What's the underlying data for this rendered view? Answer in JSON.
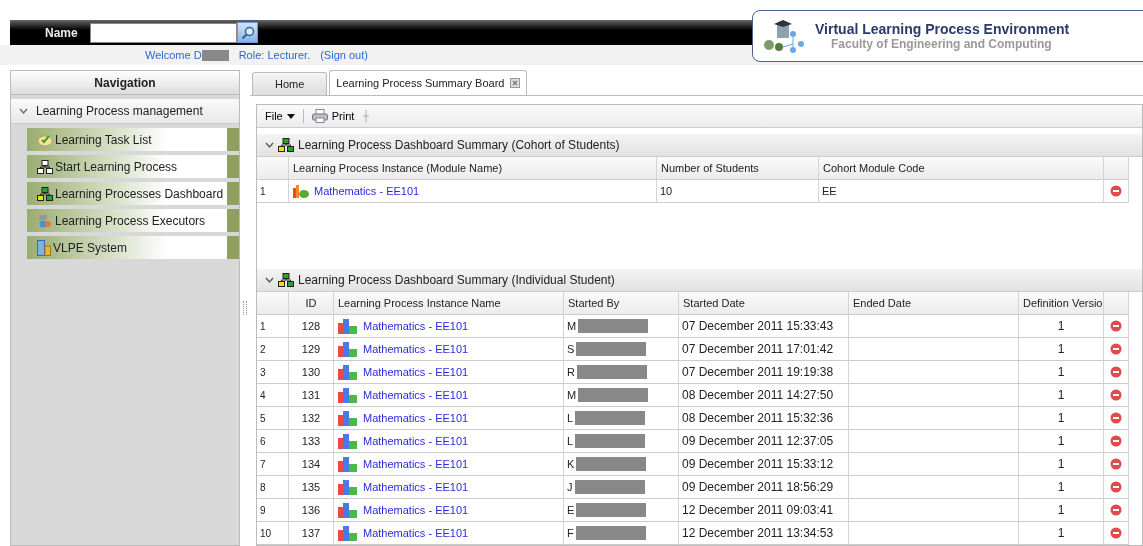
{
  "header": {
    "name_label": "Name",
    "welcome": "Welcome D",
    "role": "Role: Lecturer.",
    "sign_out": "(Sign out)"
  },
  "logo": {
    "title": "Virtual Learning Process Environment",
    "subtitle": "Faculty of Engineering and Computing"
  },
  "navigation": {
    "title": "Navigation",
    "group": {
      "label": "Learning Process management",
      "expanded": true,
      "items": [
        {
          "label": "Learning Task List"
        },
        {
          "label": "Start Learning Process"
        },
        {
          "label": "Learning Processes Dashboard"
        },
        {
          "label": "Learning Process Executors"
        },
        {
          "label": "VLPE System"
        }
      ]
    }
  },
  "tabs": [
    {
      "label": "Home",
      "selected": false,
      "closable": false
    },
    {
      "label": "Learning Process Summary Board",
      "selected": true,
      "closable": true
    }
  ],
  "toolbar": {
    "file": "File",
    "print": "Print"
  },
  "cohort": {
    "title": "Learning Process Dashboard Summary (Cohort of Students)",
    "expanded": true,
    "columns": [
      "Learning Process Instance (Module Name)",
      "Number of Students",
      "Cohort Module Code"
    ],
    "rows": [
      {
        "index": "1",
        "instance": "Mathematics - EE101",
        "students": "10",
        "code": "EE"
      }
    ]
  },
  "individual": {
    "title": "Learning Process Dashboard Summary (Individual Student)",
    "expanded": true,
    "columns": [
      "ID",
      "Learning Process Instance Name",
      "Started By",
      "Started Date",
      "Ended Date",
      "Definition Versio"
    ],
    "rows": [
      {
        "index": "1",
        "id": "128",
        "instance": "Mathematics - EE101",
        "started_by": "M",
        "started_date": "07 December 2011 15:33:43",
        "version": "1"
      },
      {
        "index": "2",
        "id": "129",
        "instance": "Mathematics - EE101",
        "started_by": "S",
        "started_date": "07 December 2011 17:01:42",
        "version": "1"
      },
      {
        "index": "3",
        "id": "130",
        "instance": "Mathematics - EE101",
        "started_by": "R",
        "started_date": "07 December 2011 19:19:38",
        "version": "1"
      },
      {
        "index": "4",
        "id": "131",
        "instance": "Mathematics - EE101",
        "started_by": "M",
        "started_date": "08 December 2011 14:27:50",
        "version": "1"
      },
      {
        "index": "5",
        "id": "132",
        "instance": "Mathematics - EE101",
        "started_by": "L",
        "started_date": "08 December 2011 15:32:36",
        "version": "1"
      },
      {
        "index": "6",
        "id": "133",
        "instance": "Mathematics - EE101",
        "started_by": "L",
        "started_date": "09 December 2011 12:37:05",
        "version": "1"
      },
      {
        "index": "7",
        "id": "134",
        "instance": "Mathematics - EE101",
        "started_by": "K",
        "started_date": "09 December 2011 15:33:12",
        "version": "1"
      },
      {
        "index": "8",
        "id": "135",
        "instance": "Mathematics - EE101",
        "started_by": "J",
        "started_date": "09 December 2011 18:56:29",
        "version": "1"
      },
      {
        "index": "9",
        "id": "136",
        "instance": "Mathematics - EE101",
        "started_by": "E",
        "started_date": "12 December 2011 09:03:41",
        "version": "1"
      },
      {
        "index": "10",
        "id": "137",
        "instance": "Mathematics - EE101",
        "started_by": "F",
        "started_date": "12 December 2011 13:34:53",
        "version": "1"
      }
    ]
  }
}
